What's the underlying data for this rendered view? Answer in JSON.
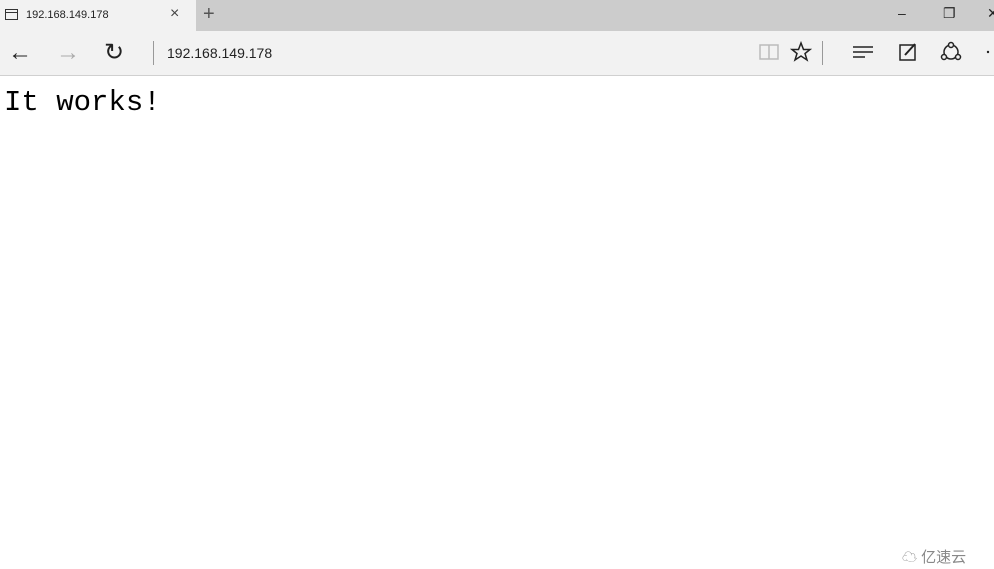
{
  "tab": {
    "title": "192.168.149.178",
    "close": "×"
  },
  "newtab": "+",
  "window": {
    "minimize": "–",
    "restore": "❐",
    "close": "✕"
  },
  "nav": {
    "back": "←",
    "forward": "→",
    "refresh": "↻"
  },
  "address": {
    "value": "192.168.149.178"
  },
  "page": {
    "text": "It works!"
  },
  "watermark": {
    "text": "亿速云"
  }
}
